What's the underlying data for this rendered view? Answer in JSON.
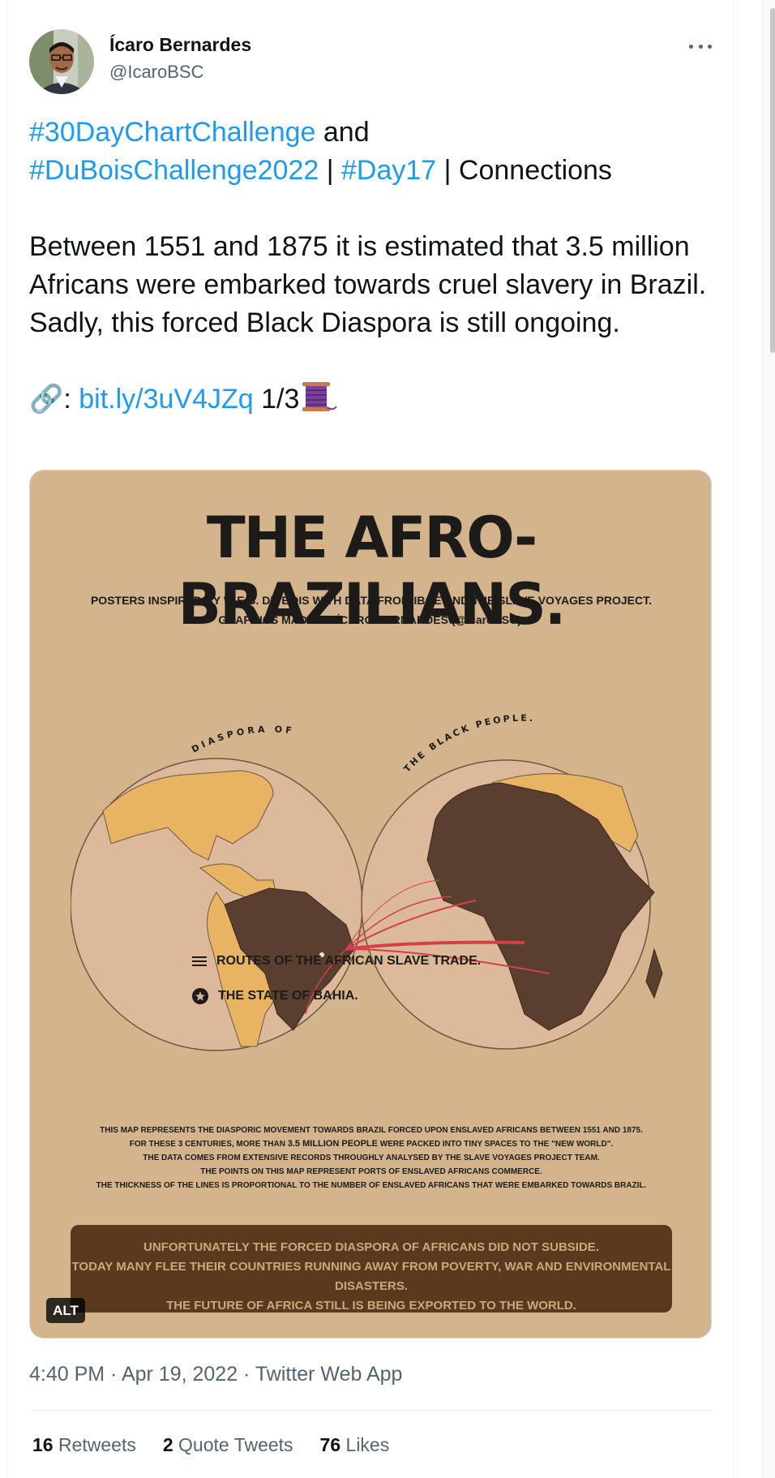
{
  "author": {
    "name": "Ícaro Bernardes",
    "handle": "@IcaroBSC"
  },
  "tweet": {
    "hashtag1": "#30DayChartChallenge",
    "text_and": " and",
    "hashtag2": "#DuBoisChallenge2022",
    "sep1": " | ",
    "hashtag3": "#Day17",
    "sep2": " | Connections",
    "body": "Between 1551 and 1875 it is estimated that 3.5 million Africans were embarked towards cruel slavery in Brazil. Sadly, this forced Black Diaspora is still ongoing.",
    "link_icon": "🔗",
    "link_prefix": ": ",
    "link": "bit.ly/3uV4JZq",
    "thread_count": " 1/3",
    "thread_emoji": "spool-of-thread-icon"
  },
  "poster": {
    "title": "THE AFRO-BRAZILIANS.",
    "subtitle_line1": "POSTERS INSPIRED BY W.E.B. DU BOIS WITH DATA FROM IBGE AND THE SLAVE VOYAGES PROJECT.",
    "subtitle_line2": "GRAPHICS MADE BY ÍCARO BERNARDES (@IcaroBSC).",
    "arc_left": "DIASPORA OF",
    "arc_right": "THE BLACK PEOPLE.",
    "legend_routes": "ROUTES OF THE AFRICAN SLAVE TRADE.",
    "legend_bahia": "THE STATE OF BAHIA.",
    "desc_line1": "THIS MAP REPRESENTS THE DIASPORIC MOVEMENT TOWARDS BRAZIL FORCED UPON ENSLAVED AFRICANS BETWEEN 1551 AND 1875.",
    "desc_line2a": "FOR THESE 3 CENTURIES, MORE THAN ",
    "desc_line2b": "3.5 MILLION PEOPLE",
    "desc_line2c": " WERE PACKED INTO TINY SPACES TO THE \"NEW WORLD\".",
    "desc_line3": "THE DATA COMES FROM EXTENSIVE RECORDS THROUGHLY ANALYSED BY THE SLAVE VOYAGES PROJECT TEAM.",
    "desc_line4": "THE POINTS ON THIS MAP REPRESENT PORTS OF ENSLAVED AFRICANS COMMERCE.",
    "desc_line5": "THE THICKNESS OF THE LINES IS PROPORTIONAL TO THE NUMBER OF ENSLAVED AFRICANS THAT WERE EMBARKED TOWARDS BRAZIL.",
    "box_line1": "UNFORTUNATELY THE FORCED DIASPORA OF AFRICANS DID NOT SUBSIDE.",
    "box_line2": "TODAY MANY FLEE THEIR COUNTRIES RUNNING AWAY FROM POVERTY, WAR AND ENVIRONMENTAL DISASTERS.",
    "box_line3": "THE FUTURE OF AFRICA STILL IS BEING EXPORTED TO THE WORLD.",
    "alt": "ALT",
    "colors": {
      "background": "#d4b48c",
      "land": "#e8b464",
      "highlight": "#5a3e2f",
      "routes": "#d4404a"
    }
  },
  "meta": {
    "timestamp": "4:40 PM · Apr 19, 2022 · Twitter Web App"
  },
  "stats": {
    "retweets_count": "16",
    "retweets_label": " Retweets",
    "quotes_count": "2",
    "quotes_label": " Quote Tweets",
    "likes_count": "76",
    "likes_label": " Likes"
  }
}
